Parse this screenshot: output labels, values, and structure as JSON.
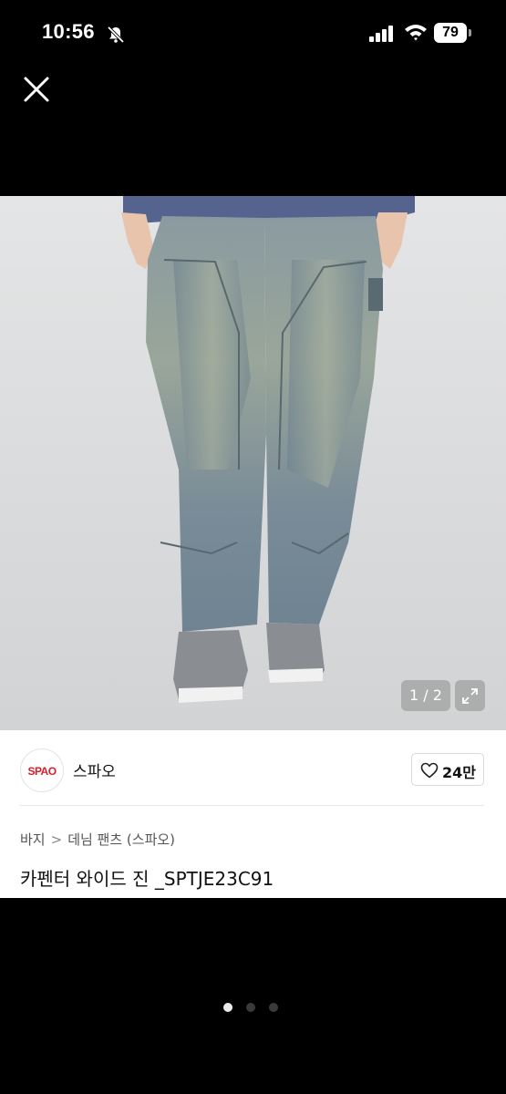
{
  "status_bar": {
    "time": "10:56",
    "battery": "79"
  },
  "colors": {
    "brand_red": "#d3202e",
    "page_bg": "#000000",
    "card_bg": "#ffffff"
  },
  "icons": {
    "close": "close-icon",
    "heart": "heart-icon",
    "expand": "expand-icon"
  },
  "gallery": {
    "counter": "1 / 2"
  },
  "seller": {
    "logo_text": "SPAO",
    "name": "스파오",
    "likes": "24만"
  },
  "breadcrumb": {
    "level1": "바지",
    "separator": ">",
    "level2": "데님 팬츠 (스파오)"
  },
  "product": {
    "title": "카펜터 와이드 진 _SPTJE23C91"
  },
  "pager": {
    "pages": 3,
    "current": 1
  }
}
